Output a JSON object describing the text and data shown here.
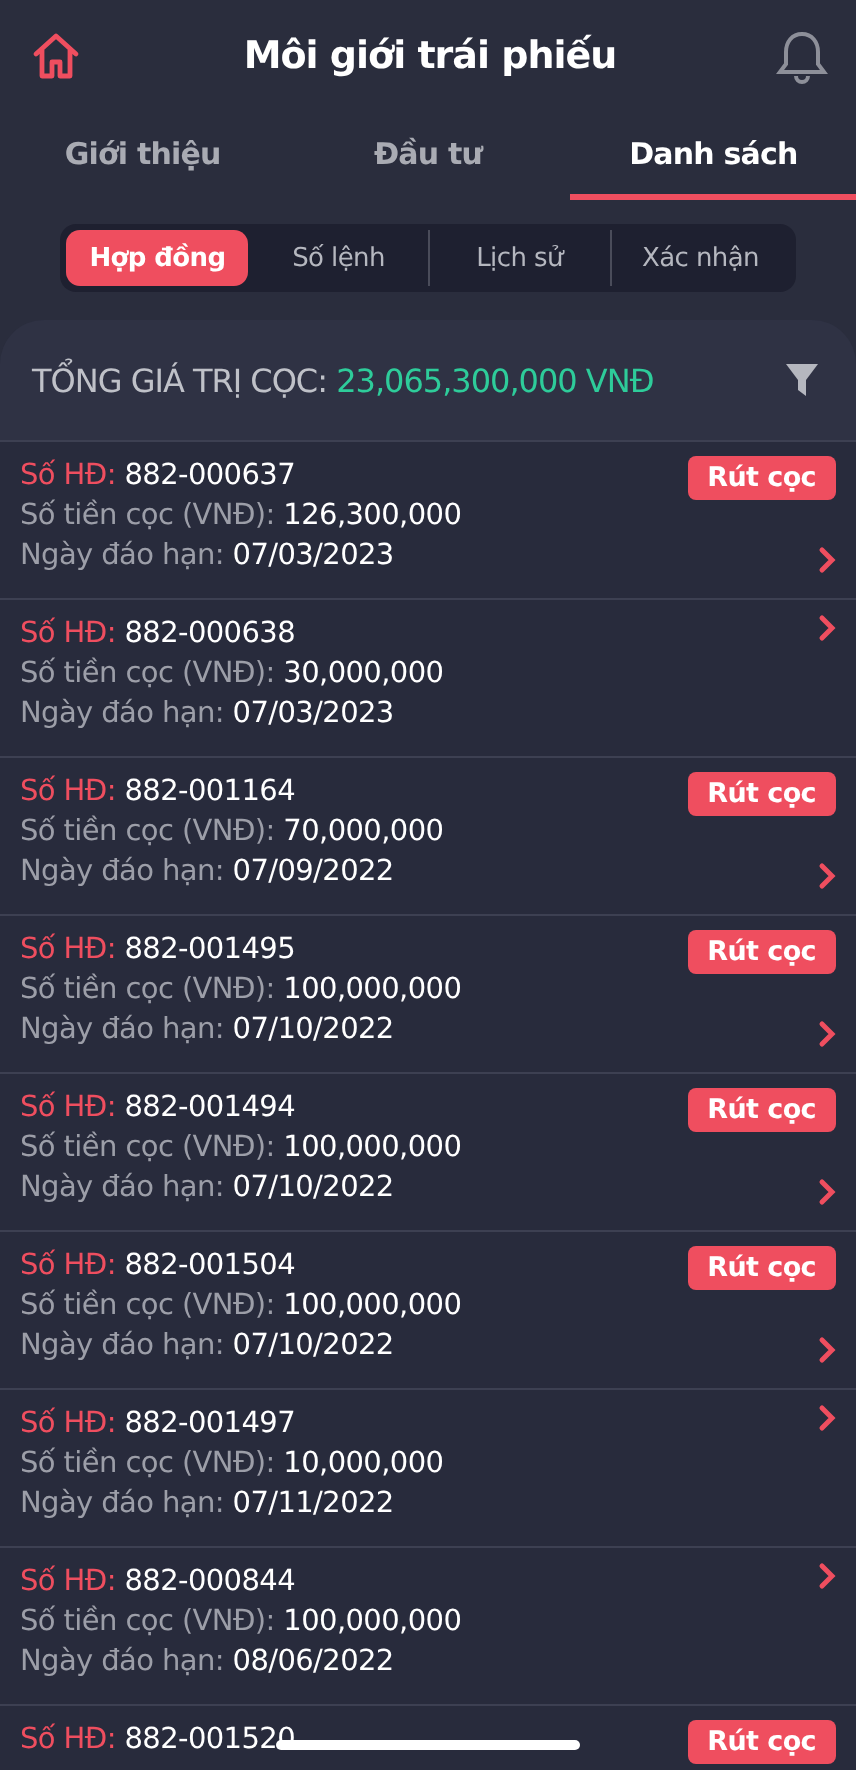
{
  "header": {
    "title": "Môi giới trái phiếu"
  },
  "tabs": [
    {
      "label": "Giới thiệu",
      "selected": false
    },
    {
      "label": "Đầu tư",
      "selected": false
    },
    {
      "label": "Danh sách",
      "selected": true
    }
  ],
  "segments": [
    {
      "label": "Hợp đồng",
      "selected": true
    },
    {
      "label": "Số lệnh",
      "selected": false
    },
    {
      "label": "Lịch sử",
      "selected": false
    },
    {
      "label": "Xác nhận",
      "selected": false
    }
  ],
  "summary": {
    "label": "TỔNG GIÁ TRỊ CỌC:",
    "value": "23,065,300,000 VNĐ"
  },
  "contracts": [
    {
      "no_label": "Số HĐ:",
      "no": "882-000637",
      "amount_label": "Số tiền cọc (VNĐ):",
      "amount": "126,300,000",
      "date_label": "Ngày đáo hạn:",
      "date": "07/03/2023",
      "action": "Rút cọc"
    },
    {
      "no_label": "Số HĐ:",
      "no": "882-000638",
      "amount_label": "Số tiền cọc (VNĐ):",
      "amount": "30,000,000",
      "date_label": "Ngày đáo hạn:",
      "date": "07/03/2023"
    },
    {
      "no_label": "Số HĐ:",
      "no": "882-001164",
      "amount_label": "Số tiền cọc (VNĐ):",
      "amount": "70,000,000",
      "date_label": "Ngày đáo hạn:",
      "date": "07/09/2022",
      "action": "Rút cọc"
    },
    {
      "no_label": "Số HĐ:",
      "no": "882-001495",
      "amount_label": "Số tiền cọc (VNĐ):",
      "amount": "100,000,000",
      "date_label": "Ngày đáo hạn:",
      "date": "07/10/2022",
      "action": "Rút cọc"
    },
    {
      "no_label": "Số HĐ:",
      "no": "882-001494",
      "amount_label": "Số tiền cọc (VNĐ):",
      "amount": "100,000,000",
      "date_label": "Ngày đáo hạn:",
      "date": "07/10/2022",
      "action": "Rút cọc"
    },
    {
      "no_label": "Số HĐ:",
      "no": "882-001504",
      "amount_label": "Số tiền cọc (VNĐ):",
      "amount": "100,000,000",
      "date_label": "Ngày đáo hạn:",
      "date": "07/10/2022",
      "action": "Rút cọc"
    },
    {
      "no_label": "Số HĐ:",
      "no": "882-001497",
      "amount_label": "Số tiền cọc (VNĐ):",
      "amount": "10,000,000",
      "date_label": "Ngày đáo hạn:",
      "date": "07/11/2022"
    },
    {
      "no_label": "Số HĐ:",
      "no": "882-000844",
      "amount_label": "Số tiền cọc (VNĐ):",
      "amount": "100,000,000",
      "date_label": "Ngày đáo hạn:",
      "date": "08/06/2022"
    },
    {
      "no_label": "Số HĐ:",
      "no": "882-001520",
      "action": "Rút cọc"
    }
  ]
}
